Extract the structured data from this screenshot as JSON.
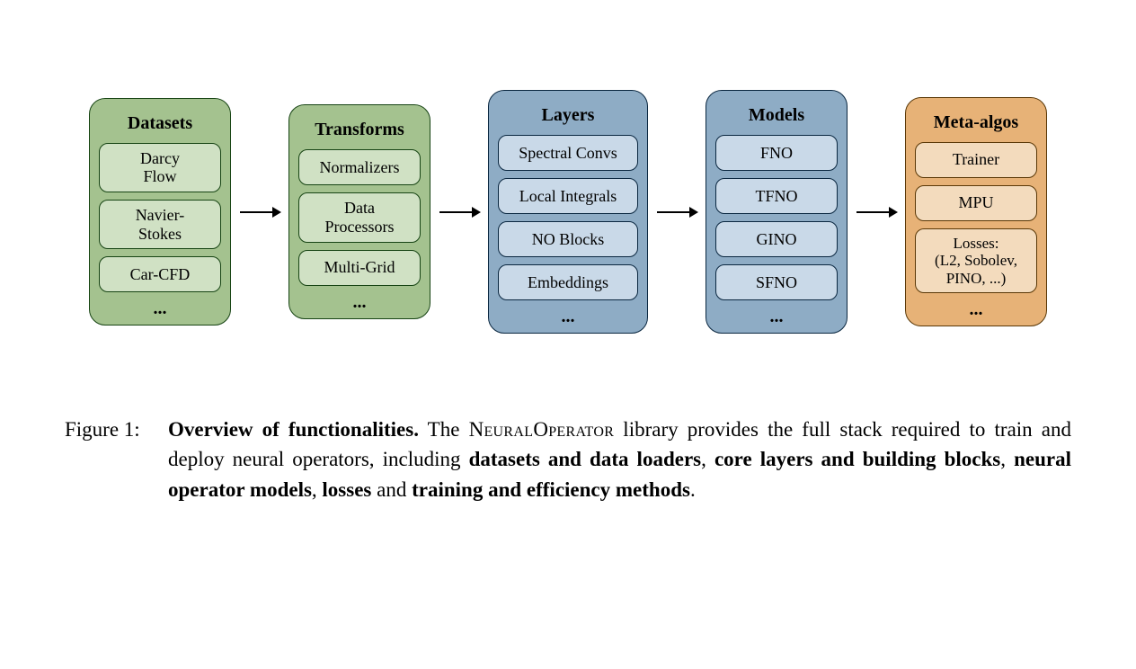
{
  "columns": [
    {
      "title": "Datasets",
      "items": [
        "Darcy\nFlow",
        "Navier-\nStokes",
        "Car-CFD"
      ],
      "ellipsis": "..."
    },
    {
      "title": "Transforms",
      "items": [
        "Normalizers",
        "Data\nProcessors",
        "Multi-Grid"
      ],
      "ellipsis": "..."
    },
    {
      "title": "Layers",
      "items": [
        "Spectral Convs",
        "Local Integrals",
        "NO Blocks",
        "Embeddings"
      ],
      "ellipsis": "..."
    },
    {
      "title": "Models",
      "items": [
        "FNO",
        "TFNO",
        "GINO",
        "SFNO"
      ],
      "ellipsis": "..."
    },
    {
      "title": "Meta-algos",
      "items": [
        "Trainer",
        "MPU",
        "Losses:\n(L2, Sobolev,\nPINO, ...)"
      ],
      "ellipsis": "..."
    }
  ],
  "caption": {
    "label": "Figure 1:",
    "lead_bold": "Overview of functionalities.",
    "t1": " The ",
    "smallcaps": "NeuralOperator",
    "t2": " library provides the full stack required to train and deploy neural operators, including ",
    "b1": "datasets and data loaders",
    "c1": ", ",
    "b2": "core layers and building blocks",
    "c2": ", ",
    "b3": "neural operator models",
    "c3": ", ",
    "b4": "losses",
    "c4": " and ",
    "b5": "training and efficiency methods",
    "c5": "."
  }
}
